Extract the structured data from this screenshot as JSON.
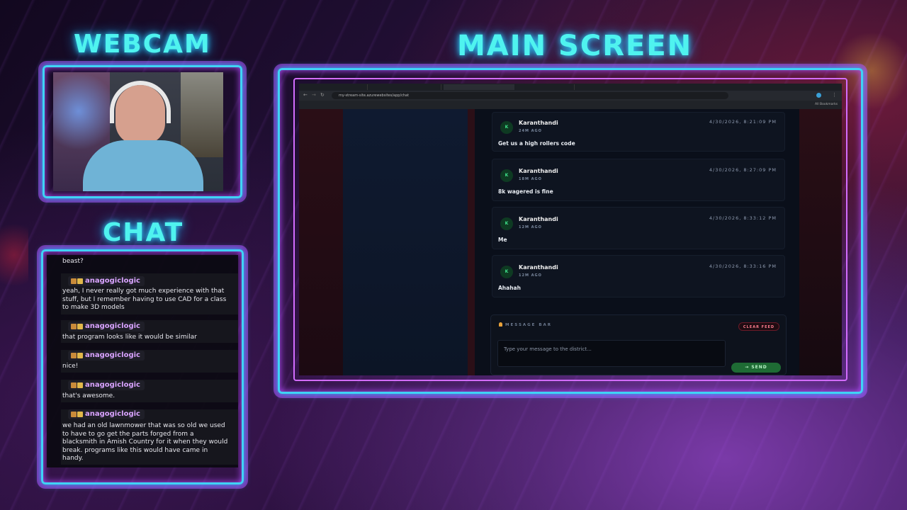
{
  "overlay": {
    "webcam_heading": "WEBCAM",
    "chat_heading": "CHAT",
    "main_heading": "MAIN SCREEN",
    "accent_cyan": "#4ff3ef",
    "accent_purple": "#d36cff"
  },
  "chat": {
    "partial_message": "beast?",
    "messages": [
      {
        "user": "anagogiclogic",
        "text": "yeah, I never really got much experience with that stuff, but I remember having to use CAD for a class to make 3D models"
      },
      {
        "user": "anagogiclogic",
        "text": "that program looks like it would be similar"
      },
      {
        "user": "anagogiclogic",
        "text": "nice!"
      },
      {
        "user": "anagogiclogic",
        "text": "that's awesome."
      },
      {
        "user": "anagogiclogic",
        "text": "we had an old lawnmower that was so old we used to have to go get the parts forged from a blacksmith in Amish Country for it when they would break. programs like this would have came in handy."
      }
    ]
  },
  "browser": {
    "url": "my-stream-site.azurewebsites/app/chat",
    "bookmarks_label": "All Bookmarks"
  },
  "feed": {
    "messages": [
      {
        "avatar": "K",
        "author": "Karanthandi",
        "ago": "24M AGO",
        "timestamp": "4/30/2026, 8:21:09 PM",
        "text": "Get us a high rollers code"
      },
      {
        "avatar": "K",
        "author": "Karanthandi",
        "ago": "18M AGO",
        "timestamp": "4/30/2026, 8:27:09 PM",
        "text": "8k wagered is fine"
      },
      {
        "avatar": "K",
        "author": "Karanthandi",
        "ago": "12M AGO",
        "timestamp": "4/30/2026, 8:33:12 PM",
        "text": "Me"
      },
      {
        "avatar": "K",
        "author": "Karanthandi",
        "ago": "12M AGO",
        "timestamp": "4/30/2026, 8:33:16 PM",
        "text": "Ahahah"
      }
    ],
    "message_bar_label": "MESSAGE BAR",
    "clear_label": "CLEAR FEED",
    "input_placeholder": "Type your message to the district...",
    "send_label": "SEND"
  }
}
